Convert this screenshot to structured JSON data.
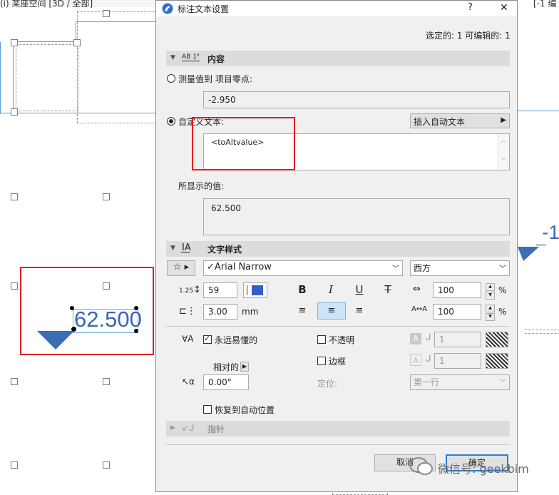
{
  "background": {
    "top_left_title": "(i) 某座空间 [3D / 全部]",
    "label_value": "62.500",
    "right_value": "-1",
    "right_title": "[-1 编"
  },
  "dialog": {
    "title": "标注文本设置",
    "help_glyph": "?",
    "close_glyph": "✕",
    "selection_info": "选定的: 1 可编辑的: 1",
    "content_section": {
      "title": "内容",
      "icon_text": "AB 1⁰",
      "measure_radio_label": "测量值到 项目零点:",
      "measure_value": "-2.950",
      "custom_radio_label": "自定义文本:",
      "insert_auto_text": "插入自动文本",
      "custom_text": "<toAltvalue>",
      "display_label": "所显示的值:",
      "display_value": "62.500"
    },
    "style_section": {
      "title": "文字样式",
      "font": "✓Arial Narrow",
      "script": "西方",
      "size_icon_text": "1.25",
      "size_value": "59",
      "bold_glyph": "B",
      "italic_glyph": "I",
      "underline_glyph": "U",
      "strike_glyph": "T",
      "width_value": "100",
      "spacing_value": "100",
      "percent": "%",
      "indent_value": "3.00",
      "indent_unit": "mm",
      "readable_label": "永远易懂的",
      "opaque_label": "不透明",
      "frame_label": "边框",
      "relative_label": "相对的",
      "position_label": "定位:",
      "position_value": "第一行",
      "pen1_value": "1",
      "pen2_value": "1",
      "angle_value": "0.00°",
      "restore_label": "恢复到自动位置"
    },
    "pointer_section": {
      "title": "指针"
    },
    "cancel_label": "取消",
    "ok_label": "确定"
  },
  "watermark": "微信号: geekbim",
  "colors": {
    "accent": "#2f6fd1",
    "label_blue": "#3a66b7",
    "marker": "#3a6eb5",
    "highlight": "#e02020"
  }
}
